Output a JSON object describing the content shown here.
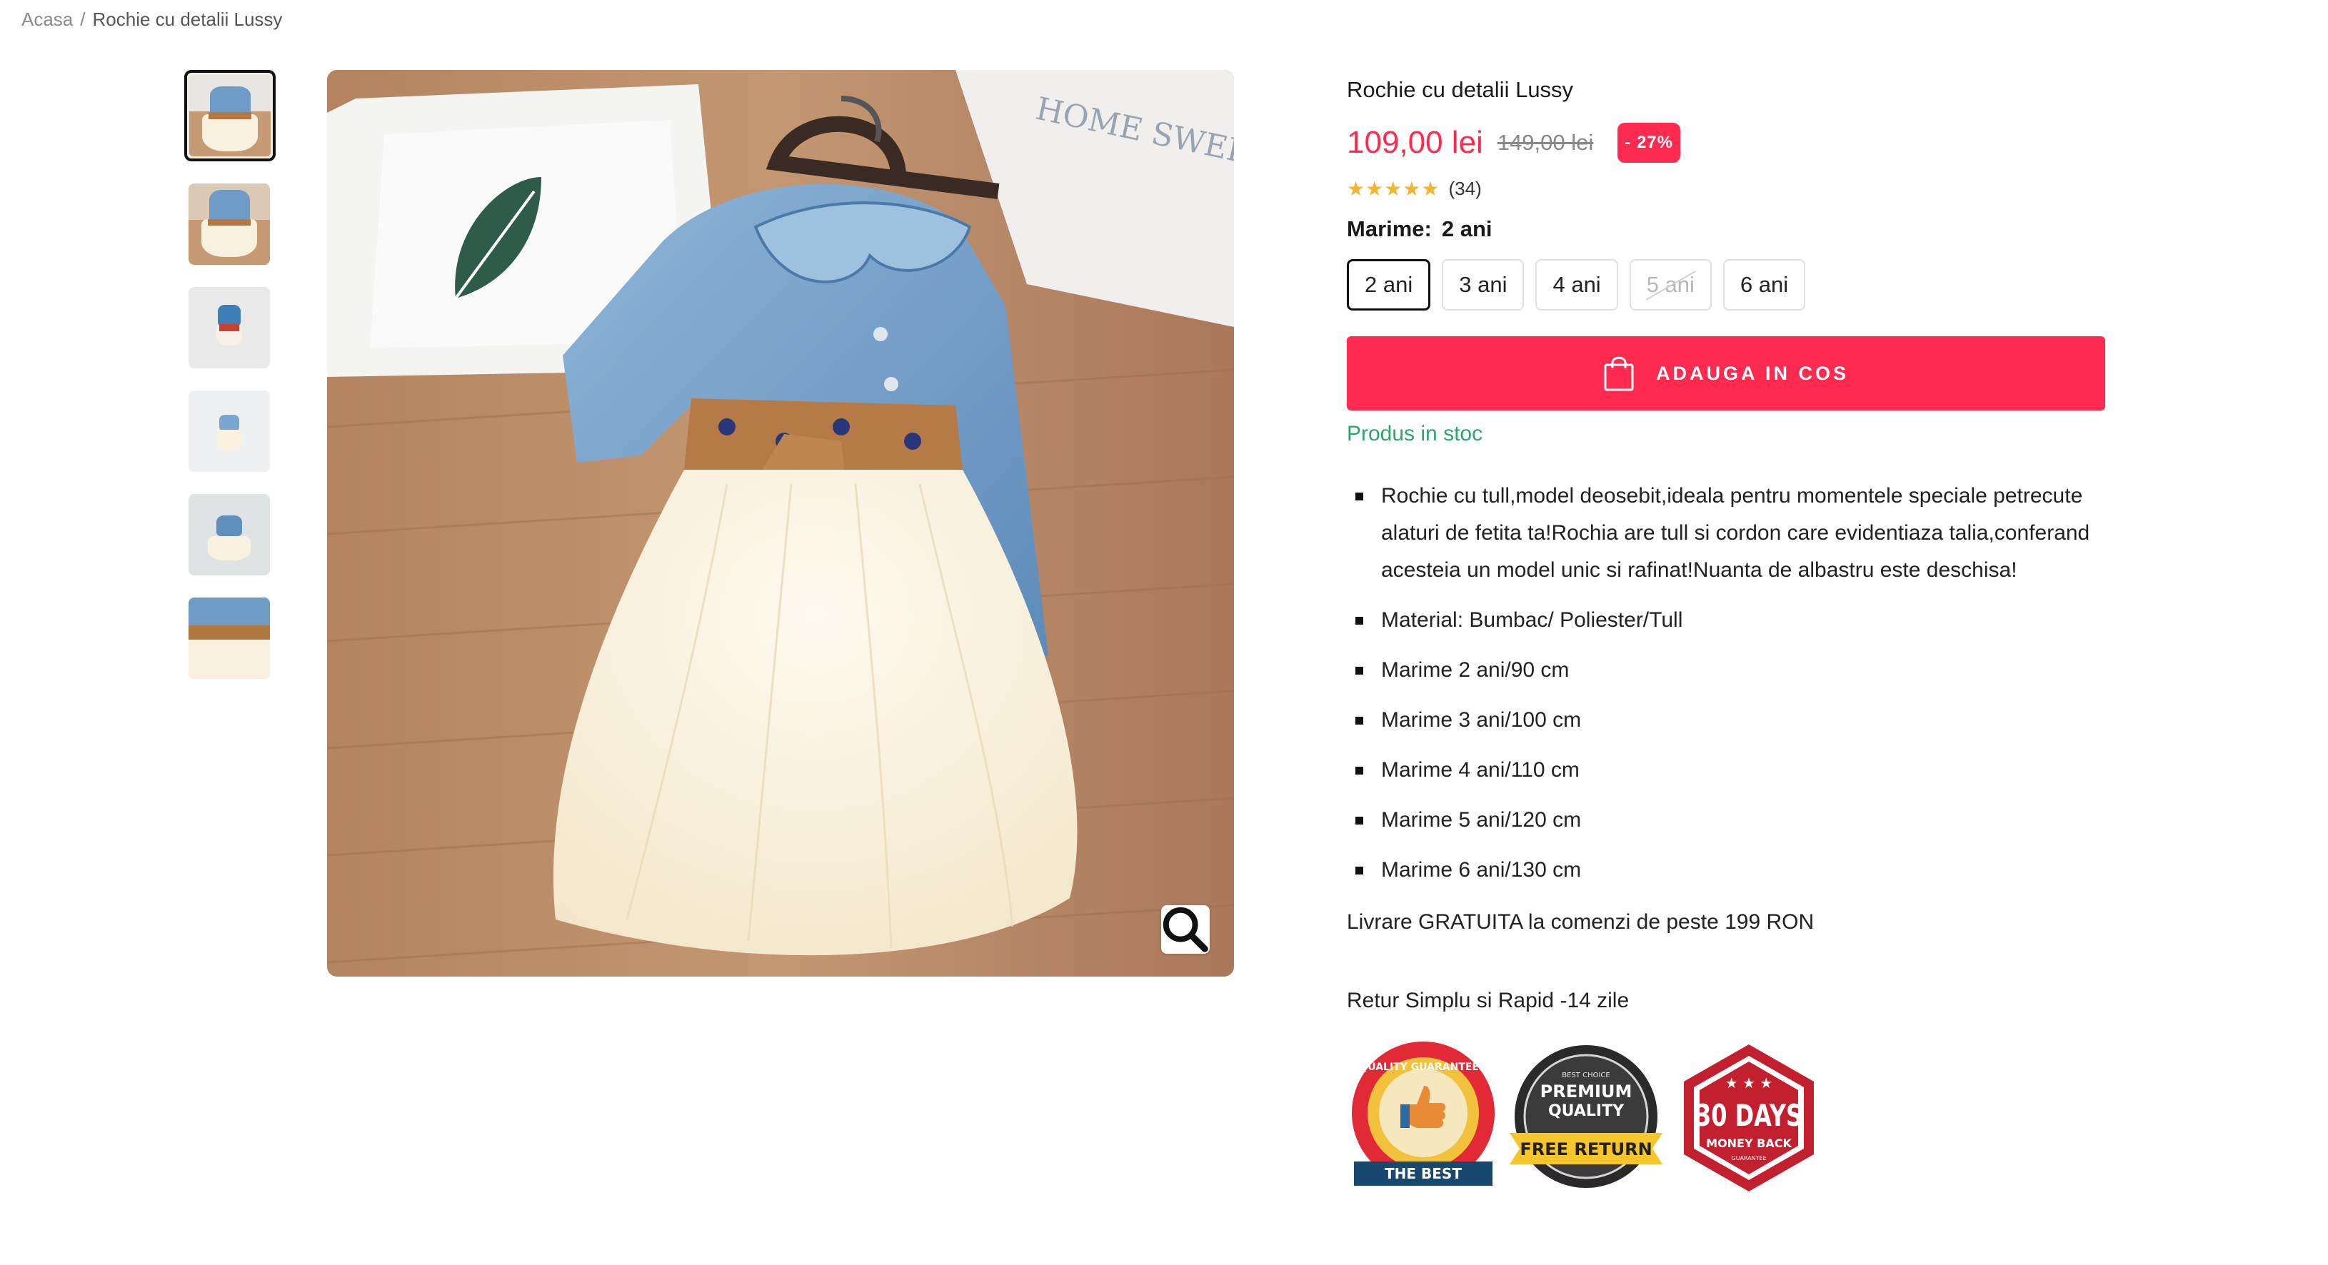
{
  "breadcrumb": {
    "home": "Acasa",
    "separator": "/",
    "current": "Rochie cu detalii Lussy"
  },
  "product": {
    "title": "Rochie cu detalii Lussy",
    "price": "109,00 lei",
    "old_price": "149,00 lei",
    "discount": "- 27%",
    "rating_stars": "★★★★★",
    "rating_count": "(34)",
    "size_label": "Marime:",
    "size_selected": "2 ani",
    "sizes": [
      {
        "label": "2 ani",
        "state": "selected"
      },
      {
        "label": "3 ani",
        "state": "available"
      },
      {
        "label": "4 ani",
        "state": "available"
      },
      {
        "label": "5 ani",
        "state": "unavailable"
      },
      {
        "label": "6 ani",
        "state": "available"
      }
    ],
    "add_to_cart": "ADAUGA IN COS",
    "stock": "Produs in stoc",
    "description": [
      "Rochie cu tull,model deosebit,ideala pentru momentele speciale petrecute alaturi de fetita ta!Rochia are tull si cordon care evidentiaza talia,conferand acesteia un model unic si rafinat!Nuanta de albastru este deschisa!",
      "Material: Bumbac/ Poliester/Tull",
      "Marime 2 ani/90 cm",
      "Marime 3 ani/100 cm",
      "Marime 4 ani/110 cm",
      "Marime 5 ani/120 cm",
      "Marime 6 ani/130 cm"
    ],
    "delivery": "Livrare GRATUITA la comenzi de peste 199 RON",
    "returns": "Retur Simplu si Rapid -14 zile"
  },
  "gallery": {
    "thumbnail_count": 6,
    "active_index": 0,
    "zoom_icon": "search-icon",
    "main_image_sign": "HOME SWEET HOME"
  },
  "badges": [
    {
      "name": "quality-guaranteed",
      "top": "QUALITY GUARANTEED",
      "ribbon": "THE BEST"
    },
    {
      "name": "premium-quality",
      "small": "BEST CHOICE",
      "line1": "PREMIUM",
      "line2": "QUALITY",
      "ribbon": "FREE RETURN"
    },
    {
      "name": "30-days",
      "big": "30 DAYS",
      "sub": "MONEY BACK",
      "tiny": "GUARANTEE"
    }
  ],
  "colors": {
    "accent": "#ff2a4f",
    "stock_green": "#2ea56b",
    "star": "#f5b532"
  }
}
